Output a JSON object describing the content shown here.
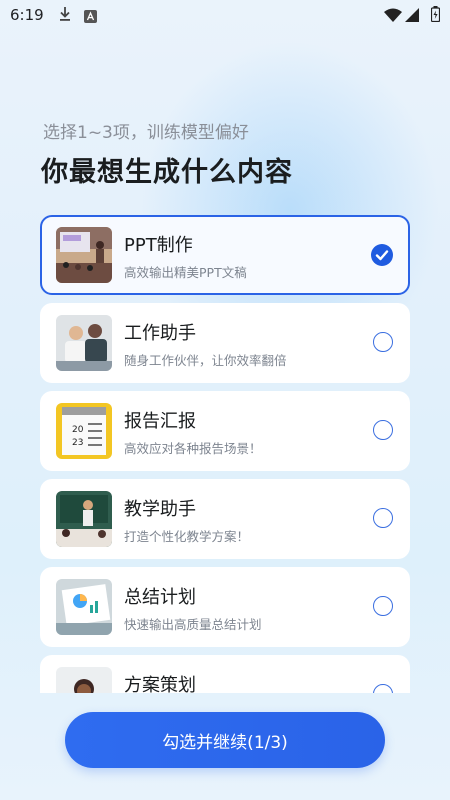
{
  "status_bar": {
    "time": "6:19",
    "icons": [
      "download-icon",
      "a-box-icon",
      "wifi-icon",
      "signal-icon",
      "battery-icon"
    ]
  },
  "header": {
    "subtitle": "选择1~3项，训练模型偏好",
    "title": "你最想生成什么内容"
  },
  "options": [
    {
      "title": "PPT制作",
      "desc": "高效输出精美PPT文稿",
      "selected": true
    },
    {
      "title": "工作助手",
      "desc": "随身工作伙伴，让你效率翻倍",
      "selected": false
    },
    {
      "title": "报告汇报",
      "desc": "高效应对各种报告场景！",
      "selected": false
    },
    {
      "title": "教学助手",
      "desc": "打造个性化教学方案！",
      "selected": false
    },
    {
      "title": "总结计划",
      "desc": "快速输出高质量总结计划",
      "selected": false
    },
    {
      "title": "方案策划",
      "desc": "",
      "selected": false
    }
  ],
  "footer": {
    "continue_label": "勾选并继续(1/3)"
  },
  "colors": {
    "accent": "#2b63e6",
    "background": "#e3f0fb"
  }
}
